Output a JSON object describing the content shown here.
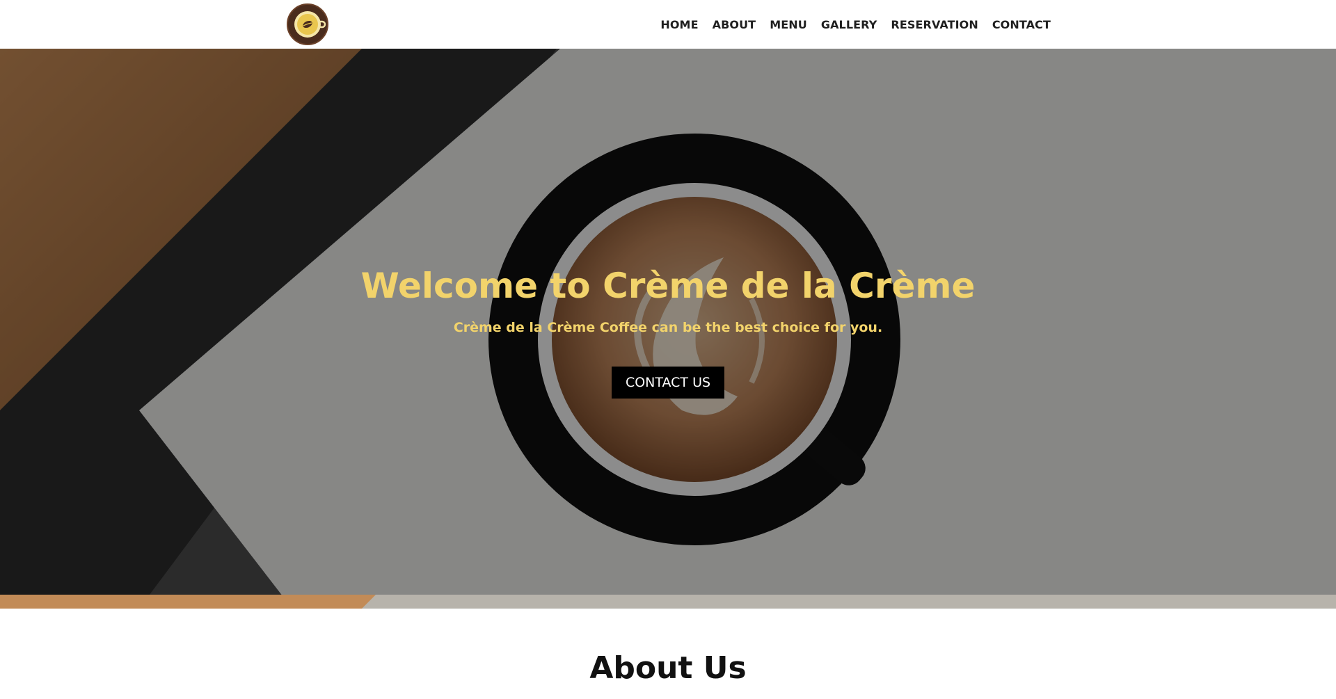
{
  "brand": {
    "logo_icon": "coffee-cup-logo-icon",
    "colors": {
      "logo_bg": "#4a2c1d",
      "accent": "#f2d36b"
    }
  },
  "nav": {
    "items": [
      {
        "label": "HOME"
      },
      {
        "label": "ABOUT"
      },
      {
        "label": "MENU"
      },
      {
        "label": "GALLERY"
      },
      {
        "label": "RESERVATION"
      },
      {
        "label": "CONTACT"
      }
    ]
  },
  "hero": {
    "title": "Welcome to Crème de la Crème",
    "subtitle": "Crème de la Crème Coffee can be the best choice for you.",
    "button_label": "CONTACT US",
    "background_icon": "latte-cup-photo",
    "colors": {
      "title": "#f2d36b",
      "button_bg": "#000000",
      "button_text": "#ffffff"
    }
  },
  "about": {
    "title": "About Us"
  }
}
